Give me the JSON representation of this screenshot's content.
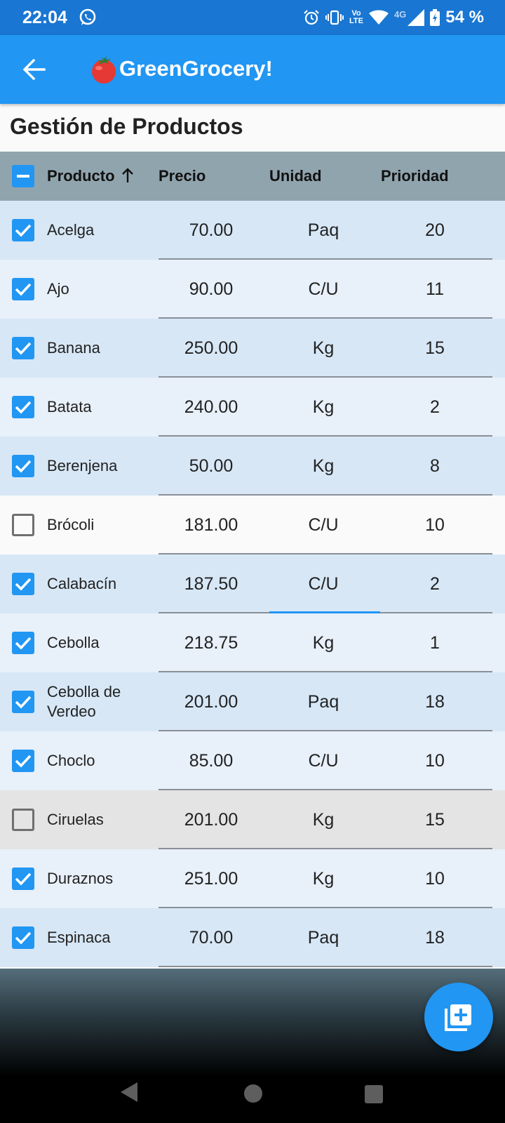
{
  "status_bar": {
    "time": "22:04",
    "volte_top": "Vo",
    "volte_bottom": "LTE",
    "network": "4G",
    "battery": "54 %"
  },
  "app_bar": {
    "title": "GreenGrocery!",
    "icons": [
      "back-arrow-icon",
      "tomato-icon"
    ]
  },
  "page": {
    "title": "Gestión de Productos"
  },
  "table": {
    "headers": {
      "producto": "Producto",
      "precio": "Precio",
      "unidad": "Unidad",
      "prioridad": "Prioridad"
    },
    "sort": {
      "column": "producto",
      "direction": "ascending"
    },
    "rows": [
      {
        "name": "Acelga",
        "precio": "70.00",
        "unidad": "Paq",
        "prioridad": "20",
        "checked": true
      },
      {
        "name": "Ajo",
        "precio": "90.00",
        "unidad": "C/U",
        "prioridad": "11",
        "checked": true
      },
      {
        "name": "Banana",
        "precio": "250.00",
        "unidad": "Kg",
        "prioridad": "15",
        "checked": true
      },
      {
        "name": "Batata",
        "precio": "240.00",
        "unidad": "Kg",
        "prioridad": "2",
        "checked": true
      },
      {
        "name": "Berenjena",
        "precio": "50.00",
        "unidad": "Kg",
        "prioridad": "8",
        "checked": true
      },
      {
        "name": "Brócoli",
        "precio": "181.00",
        "unidad": "C/U",
        "prioridad": "10",
        "checked": false
      },
      {
        "name": "Calabacín",
        "precio": "187.50",
        "unidad": "C/U",
        "prioridad": "2",
        "checked": true
      },
      {
        "name": "Cebolla",
        "precio": "218.75",
        "unidad": "Kg",
        "prioridad": "1",
        "checked": true
      },
      {
        "name": "Cebolla de Verdeo",
        "precio": "201.00",
        "unidad": "Paq",
        "prioridad": "18",
        "checked": true
      },
      {
        "name": "Choclo",
        "precio": "85.00",
        "unidad": "C/U",
        "prioridad": "10",
        "checked": true
      },
      {
        "name": "Ciruelas",
        "precio": "201.00",
        "unidad": "Kg",
        "prioridad": "15",
        "checked": false
      },
      {
        "name": "Duraznos",
        "precio": "251.00",
        "unidad": "Kg",
        "prioridad": "10",
        "checked": true
      },
      {
        "name": "Espinaca",
        "precio": "70.00",
        "unidad": "Paq",
        "prioridad": "18",
        "checked": true
      }
    ]
  },
  "fab": {
    "icon": "add-to-library-icon"
  },
  "colors": {
    "status_bar": "#1976d2",
    "app_bar": "#2196f3",
    "header_row": "#90a4ae",
    "selected_row_a": "#d7e7f6",
    "selected_row_b": "#e8f0f9",
    "unselected_row_a": "#fafafa",
    "unselected_row_b": "#e4e4e4",
    "accent": "#2196f3"
  }
}
